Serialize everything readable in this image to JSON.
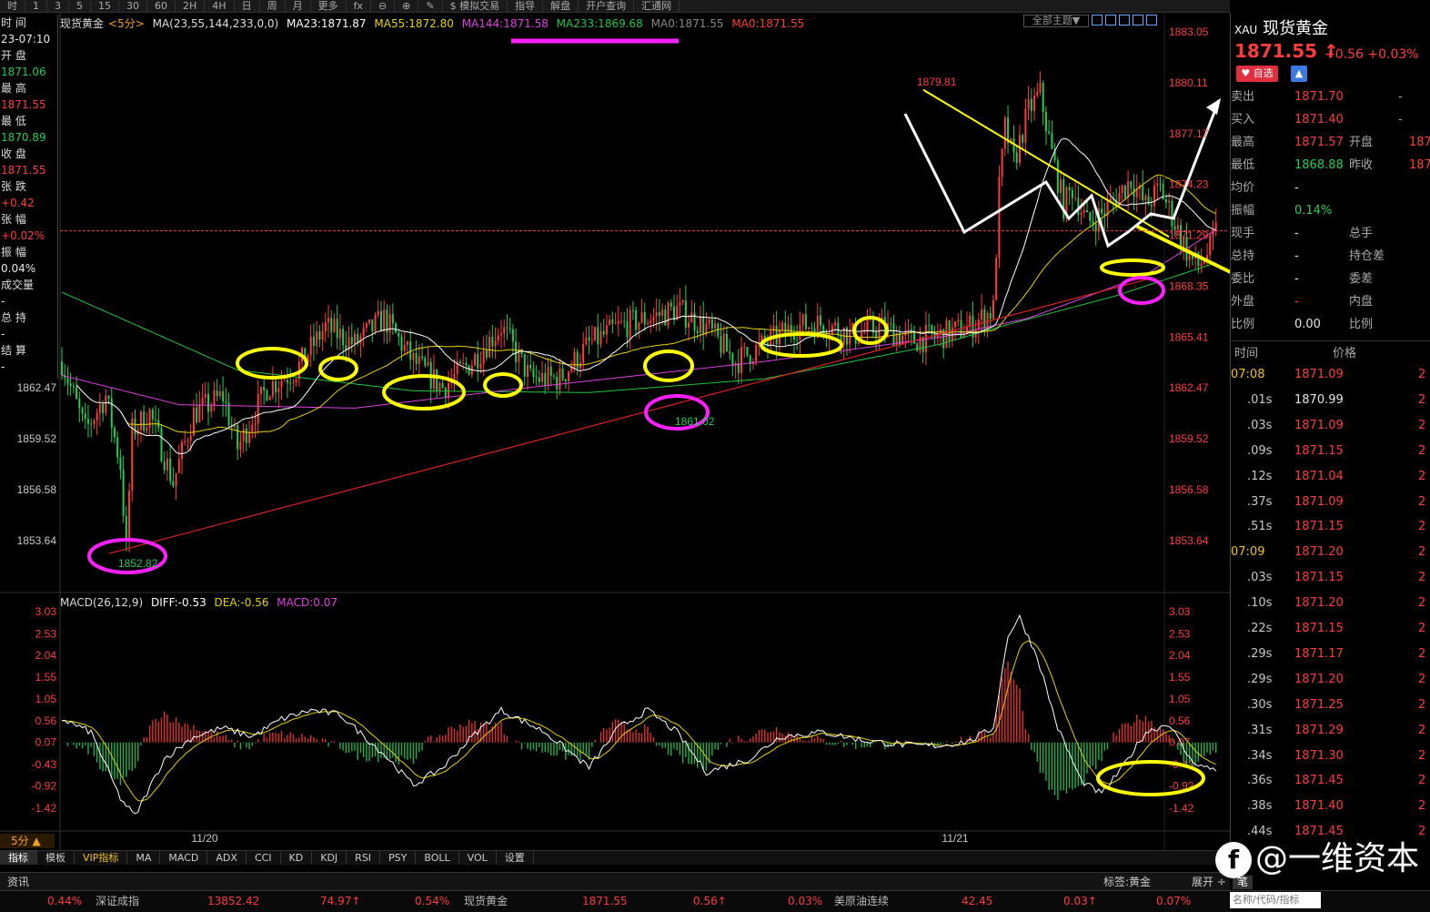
{
  "topbar": {
    "items": [
      "时",
      "1",
      "3",
      "5",
      "15",
      "30",
      "60",
      "2H",
      "4H",
      "日",
      "周",
      "月",
      "更多",
      "fx",
      "⊖",
      "⊕",
      "✎",
      "$ 模拟交易",
      "指导",
      "解盘",
      "开户查询",
      "汇通网"
    ]
  },
  "left_info": {
    "items": [
      {
        "label": "时 间",
        "value": "23-07:10",
        "color": "white"
      },
      {
        "label": "开 盘",
        "value": "1871.06",
        "color": "green"
      },
      {
        "label": "最 高",
        "value": "1871.55",
        "color": "red"
      },
      {
        "label": "最 低",
        "value": "1870.89",
        "color": "green"
      },
      {
        "label": "收 盘",
        "value": "1871.55",
        "color": "red"
      },
      {
        "label": "张 跌",
        "value": "+0.42",
        "color": "red"
      },
      {
        "label": "张 幅",
        "value": "+0.02%",
        "color": "red"
      },
      {
        "label": "振 幅",
        "value": "0.04%",
        "color": "white"
      },
      {
        "label": "成交量",
        "value": "-",
        "color": "white"
      },
      {
        "label": "总 持",
        "value": "-",
        "color": "white"
      },
      {
        "label": "结 算",
        "value": "-",
        "color": "white"
      }
    ]
  },
  "ma_legend": {
    "symbol": "现货黄金",
    "period": "<5分>",
    "ma_params": "MA(23,55,144,233,0,0)",
    "ma23": "MA23:1871.87",
    "ma55": "MA55:1872.80",
    "ma144": "MA144:1871.58",
    "ma233": "MA233:1869.68",
    "ma0a": "MA0:1871.55",
    "ma0b": "MA0:1871.55"
  },
  "theme_button": "全部主题▼",
  "price_axis": [
    "1883.05",
    "1880.11",
    "1877.17",
    "1874.23",
    "1871.29",
    "1868.35",
    "1865.41",
    "1862.47",
    "1859.52",
    "1856.58",
    "1853.64"
  ],
  "price_axis_left": [
    "1862.47",
    "1859.52",
    "1856.58",
    "1853.64"
  ],
  "annotations": {
    "high": "1879.81",
    "low": "1852.82",
    "mid_low": "1861.02",
    "cur_small": "1871.55"
  },
  "macd_legend": {
    "params": "MACD(26,12,9)",
    "diff": "DIFF:-0.53",
    "dea": "DEA:-0.56",
    "macd": "MACD:0.07"
  },
  "macd_axis": [
    "3.03",
    "2.53",
    "2.04",
    "1.55",
    "1.05",
    "0.56",
    "0.07",
    "-0.43",
    "-0.92",
    "-1.42"
  ],
  "date_axis": [
    "11/20",
    "11/21"
  ],
  "period_button": "5分 ▲",
  "bottom_tabs": [
    "指标",
    "模板",
    "VIP指标",
    "MA",
    "MACD",
    "ADX",
    "CCI",
    "KD",
    "KDJ",
    "RSI",
    "PSY",
    "BOLL",
    "VOL",
    "设置"
  ],
  "news": {
    "label": "资讯",
    "tag": "标签:黄金",
    "expand": "展开 ÷"
  },
  "ticker": [
    {
      "text": "0.44%",
      "color": "red"
    },
    {
      "text": "深证成指",
      "color": "gray"
    },
    {
      "text": "13852.42",
      "color": "red"
    },
    {
      "text": "74.97↑",
      "color": "red"
    },
    {
      "text": "0.54%",
      "color": "red"
    },
    {
      "text": "现货黄金",
      "color": "gray"
    },
    {
      "text": "1871.55",
      "color": "red"
    },
    {
      "text": "0.56↑",
      "color": "red"
    },
    {
      "text": "0.03%",
      "color": "red"
    },
    {
      "text": "美原油连续",
      "color": "gray"
    },
    {
      "text": "42.45",
      "color": "red"
    },
    {
      "text": "0.03↑",
      "color": "red"
    },
    {
      "text": "0.07%",
      "color": "red"
    }
  ],
  "side": {
    "code": "XAU",
    "name": "现货黄金",
    "price": "1871.55 ↑",
    "change": "+0.56  +0.03%",
    "fav": "♥ 自选",
    "quotes": [
      {
        "l": "卖出",
        "v": "1871.70",
        "c": "red",
        "l2": "-",
        "v2": ""
      },
      {
        "l": "买入",
        "v": "1871.40",
        "c": "red",
        "l2": "-",
        "v2": ""
      },
      {
        "l": "最高",
        "v": "1871.57",
        "c": "red",
        "l2": "开盘",
        "v2": "187"
      },
      {
        "l": "最低",
        "v": "1868.88",
        "c": "green",
        "l2": "昨收",
        "v2": "187"
      },
      {
        "l": "均价",
        "v": "-",
        "c": "white",
        "l2": "",
        "v2": ""
      },
      {
        "l": "振幅",
        "v": "0.14%",
        "c": "green",
        "l2": "",
        "v2": ""
      },
      {
        "l": "现手",
        "v": "-",
        "c": "white",
        "l2": "总手",
        "v2": ""
      },
      {
        "l": "总持",
        "v": "-",
        "c": "white",
        "l2": "持仓差",
        "v2": ""
      },
      {
        "l": "委比",
        "v": "-",
        "c": "white",
        "l2": "委差",
        "v2": ""
      },
      {
        "l": "外盘",
        "v": "-",
        "c": "red",
        "l2": "内盘",
        "v2": ""
      },
      {
        "l": "比例",
        "v": "0.00",
        "c": "white",
        "l2": "比例",
        "v2": ""
      }
    ],
    "time_header": "时间",
    "price_header": "价格",
    "ticks": [
      {
        "t": "07:08",
        "p": "1871.09",
        "tc": "gold",
        "pc": "red"
      },
      {
        "t": ".01s",
        "p": "1870.99",
        "tc": "gray",
        "pc": "white"
      },
      {
        "t": ".03s",
        "p": "1871.09",
        "tc": "gray",
        "pc": "red"
      },
      {
        "t": ".09s",
        "p": "1871.15",
        "tc": "gray",
        "pc": "red"
      },
      {
        "t": ".12s",
        "p": "1871.04",
        "tc": "gray",
        "pc": "red"
      },
      {
        "t": ".37s",
        "p": "1871.09",
        "tc": "gray",
        "pc": "red"
      },
      {
        "t": ".51s",
        "p": "1871.15",
        "tc": "gray",
        "pc": "red"
      },
      {
        "t": "07:09",
        "p": "1871.20",
        "tc": "gold",
        "pc": "red"
      },
      {
        "t": ".03s",
        "p": "1871.15",
        "tc": "gray",
        "pc": "red"
      },
      {
        "t": ".10s",
        "p": "1871.20",
        "tc": "gray",
        "pc": "red"
      },
      {
        "t": ".22s",
        "p": "1871.15",
        "tc": "gray",
        "pc": "red"
      },
      {
        "t": ".29s",
        "p": "1871.17",
        "tc": "gray",
        "pc": "red"
      },
      {
        "t": ".29s",
        "p": "1871.20",
        "tc": "gray",
        "pc": "red"
      },
      {
        "t": ".30s",
        "p": "1871.25",
        "tc": "gray",
        "pc": "red"
      },
      {
        "t": ".31s",
        "p": "1871.29",
        "tc": "gray",
        "pc": "red"
      },
      {
        "t": ".34s",
        "p": "1871.30",
        "tc": "gray",
        "pc": "red"
      },
      {
        "t": ".36s",
        "p": "1871.45",
        "tc": "gray",
        "pc": "red"
      },
      {
        "t": ".38s",
        "p": "1871.40",
        "tc": "gray",
        "pc": "red"
      },
      {
        "t": ".44s",
        "p": "1871.45",
        "tc": "gray",
        "pc": "red"
      }
    ]
  },
  "watermark": "@一维资本",
  "search_placeholder": "名称/代码/指标",
  "bi_label": "笔",
  "colors": {
    "up": "#ff3c3c",
    "down": "#22cc55",
    "ma23": "#ffffff",
    "ma55": "#e6d200",
    "ma144": "#e040e0",
    "ma233": "#20c840",
    "annot_yellow": "#ffff00",
    "annot_magenta": "#ff20ff"
  }
}
